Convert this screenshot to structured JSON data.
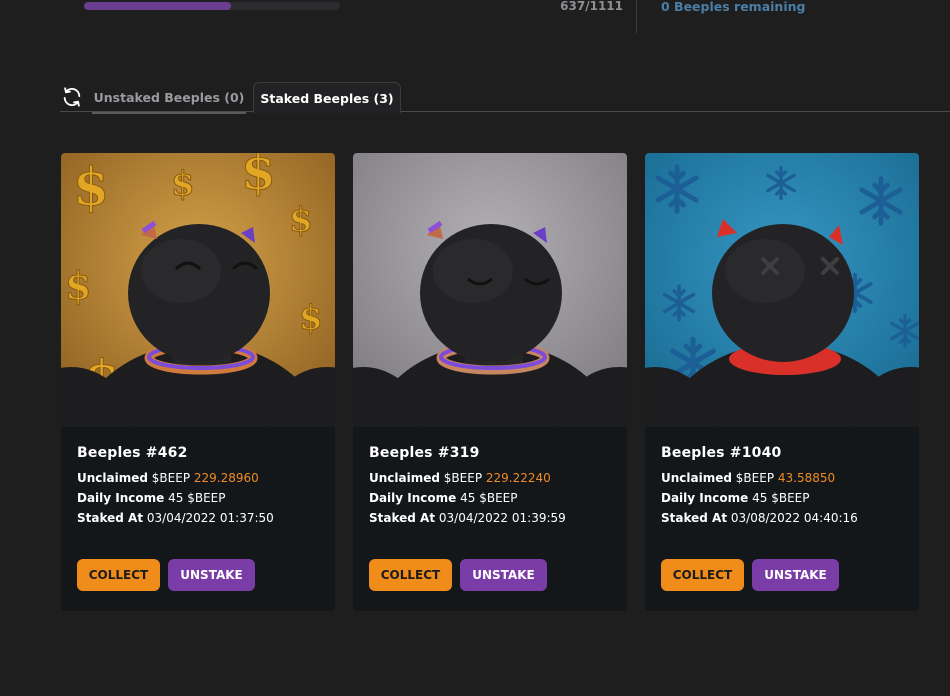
{
  "mint": {
    "progress_fraction": 0.573,
    "count_text": "637/1111",
    "remaining_text": "0 Beeples remaining"
  },
  "tabs": {
    "unstaked_label": "Unstaked Beeples (0)",
    "staked_label": "Staked Beeples (3)",
    "active": "staked"
  },
  "labels": {
    "unclaimed": "Unclaimed",
    "daily_income": "Daily Income",
    "staked_at": "Staked At",
    "currency": "$BEEP",
    "collect": "COLLECT",
    "unstake": "UNSTAKE"
  },
  "cards": [
    {
      "name": "Beeples #462",
      "unclaimed": "229.28960",
      "daily_income": "45",
      "staked_at": "03/04/2022 01:37:50",
      "background_theme": "gold-dollar-signs",
      "bg_color": "#b88935",
      "accent_color": "#7b4cd9",
      "eyes": "happy"
    },
    {
      "name": "Beeples #319",
      "unclaimed": "229.22240",
      "daily_income": "45",
      "staked_at": "03/04/2022 01:39:59",
      "background_theme": "plain-grey",
      "bg_color": "#8e8c90",
      "accent_color": "#7b4cd9",
      "eyes": "sleepy"
    },
    {
      "name": "Beeples #1040",
      "unclaimed": "43.58850",
      "daily_income": "45",
      "staked_at": "03/08/2022 04:40:16",
      "background_theme": "blue-snowflakes",
      "bg_color": "#2a86b0",
      "accent_color": "#e0322a",
      "eyes": "x-eyes"
    }
  ]
}
